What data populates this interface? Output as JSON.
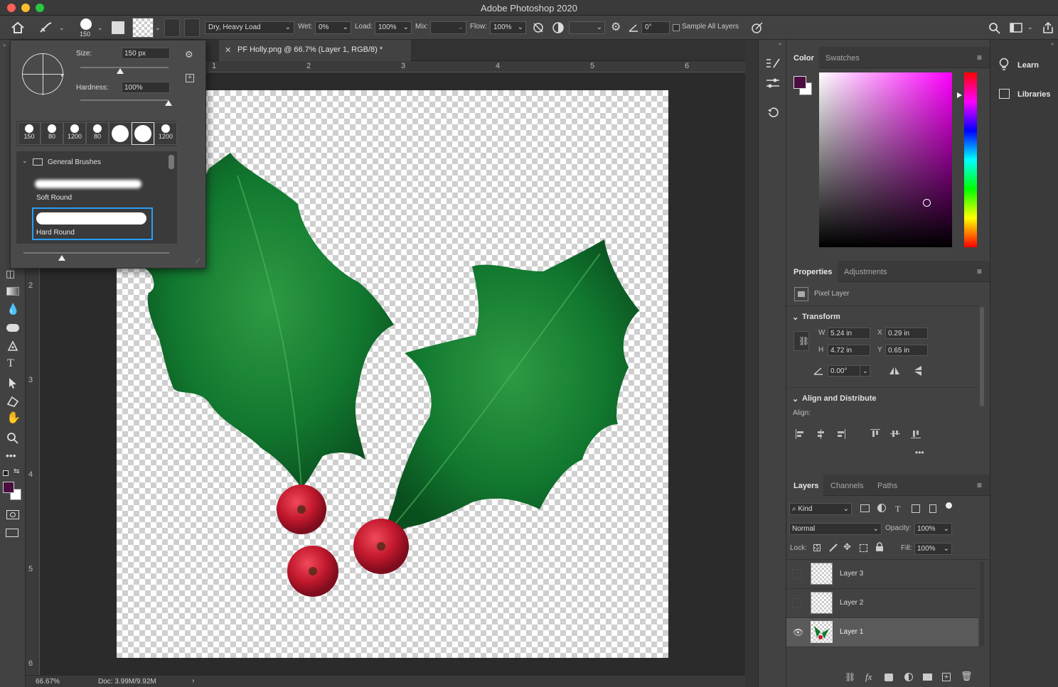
{
  "window": {
    "title": "Adobe Photoshop 2020"
  },
  "options_bar": {
    "brush_size": "150",
    "brush_combo": "Dry, Heavy Load",
    "wet_label": "Wet:",
    "wet_value": "0%",
    "load_label": "Load:",
    "load_value": "100%",
    "mix_label": "Mix:",
    "mix_value": "",
    "flow_label": "Flow:",
    "flow_value": "100%",
    "angle_value": "0°",
    "sample_all_layers": "Sample All Layers"
  },
  "document": {
    "tab_title": "PF Holly.png @ 66.7% (Layer 1, RGB/8) *",
    "top_ruler_marks": [
      "1",
      "2",
      "3",
      "4",
      "5",
      "6"
    ],
    "left_ruler_marks": [
      "2",
      "3",
      "4",
      "5",
      "6"
    ]
  },
  "status": {
    "zoom": "66.67%",
    "doc": "Doc: 3.99M/9.92M"
  },
  "brush_popup": {
    "size_label": "Size:",
    "size_value": "150 px",
    "size_fraction": 0.45,
    "hardness_label": "Hardness:",
    "hardness_value": "100%",
    "hardness_fraction": 1.0,
    "presets": [
      "150",
      "80",
      "1200",
      "80",
      "",
      "",
      "1200"
    ],
    "group": "General Brushes",
    "brushes": [
      "Soft Round",
      "Hard Round"
    ],
    "selected_brush": "Hard Round"
  },
  "color_panel": {
    "tabs": [
      "Color",
      "Swatches"
    ],
    "foreground": "#4a0f3f",
    "background": "#ffffff",
    "hue": "#ff00ff"
  },
  "properties_panel": {
    "tabs": [
      "Properties",
      "Adjustments"
    ],
    "layer_type": "Pixel Layer",
    "transform_label": "Transform",
    "w_label": "W",
    "w_value": "5.24 in",
    "h_label": "H",
    "h_value": "4.72 in",
    "x_label": "X",
    "x_value": "0.29 in",
    "y_label": "Y",
    "y_value": "0.65 in",
    "angle_value": "0.00°",
    "align_label": "Align and Distribute",
    "align_sub": "Align:"
  },
  "layers_panel": {
    "tabs": [
      "Layers",
      "Channels",
      "Paths"
    ],
    "filter_kind": "Kind",
    "blend_mode": "Normal",
    "opacity_label": "Opacity:",
    "opacity_value": "100%",
    "lock_label": "Lock:",
    "fill_label": "Fill:",
    "fill_value": "100%",
    "layers": [
      {
        "name": "Layer 3",
        "visible": false
      },
      {
        "name": "Layer 2",
        "visible": false
      },
      {
        "name": "Layer 1",
        "visible": true
      }
    ]
  },
  "learn_panel": {
    "learn": "Learn",
    "libraries": "Libraries"
  }
}
